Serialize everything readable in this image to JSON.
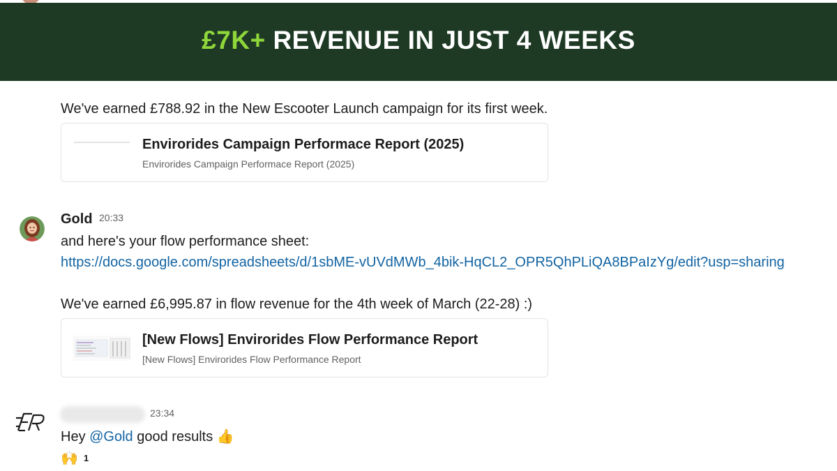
{
  "banner": {
    "highlight": "£7K+",
    "title": "REVENUE IN JUST 4 WEEKS",
    "highlight_color": "#8fd63a",
    "background": "#1e3a25"
  },
  "messages": [
    {
      "text": "We've earned £788.92 in the New Escooter Launch campaign for its first week.",
      "attachment": {
        "title": "Envirorides Campaign Performace Report (2025)",
        "subtitle": "Envirorides Campaign Performace Report (2025)"
      }
    },
    {
      "sender": "Gold",
      "time": "20:33",
      "lines": [
        "and here's your flow performance sheet:",
        "https://docs.google.com/spreadsheets/d/1sbME-vUVdMWb_4bik-HqCL2_OPR5QhPLiQA8BPaIzYg/edit?usp=sharing"
      ],
      "text2": "We've earned £6,995.87 in flow revenue for the 4th week of March (22-28) :)",
      "attachment": {
        "title": "[New Flows] Envirorides Flow Performance Report",
        "subtitle": "[New Flows] Envirorides Flow Performance Report"
      }
    },
    {
      "time": "23:34",
      "text_prefix": "Hey ",
      "mention": "@Gold",
      "text_suffix": " good results ",
      "emoji": "👍",
      "reaction": {
        "emoji": "🙌",
        "count": "1"
      }
    }
  ],
  "colors": {
    "link": "#1264a3",
    "muted": "#616061"
  }
}
